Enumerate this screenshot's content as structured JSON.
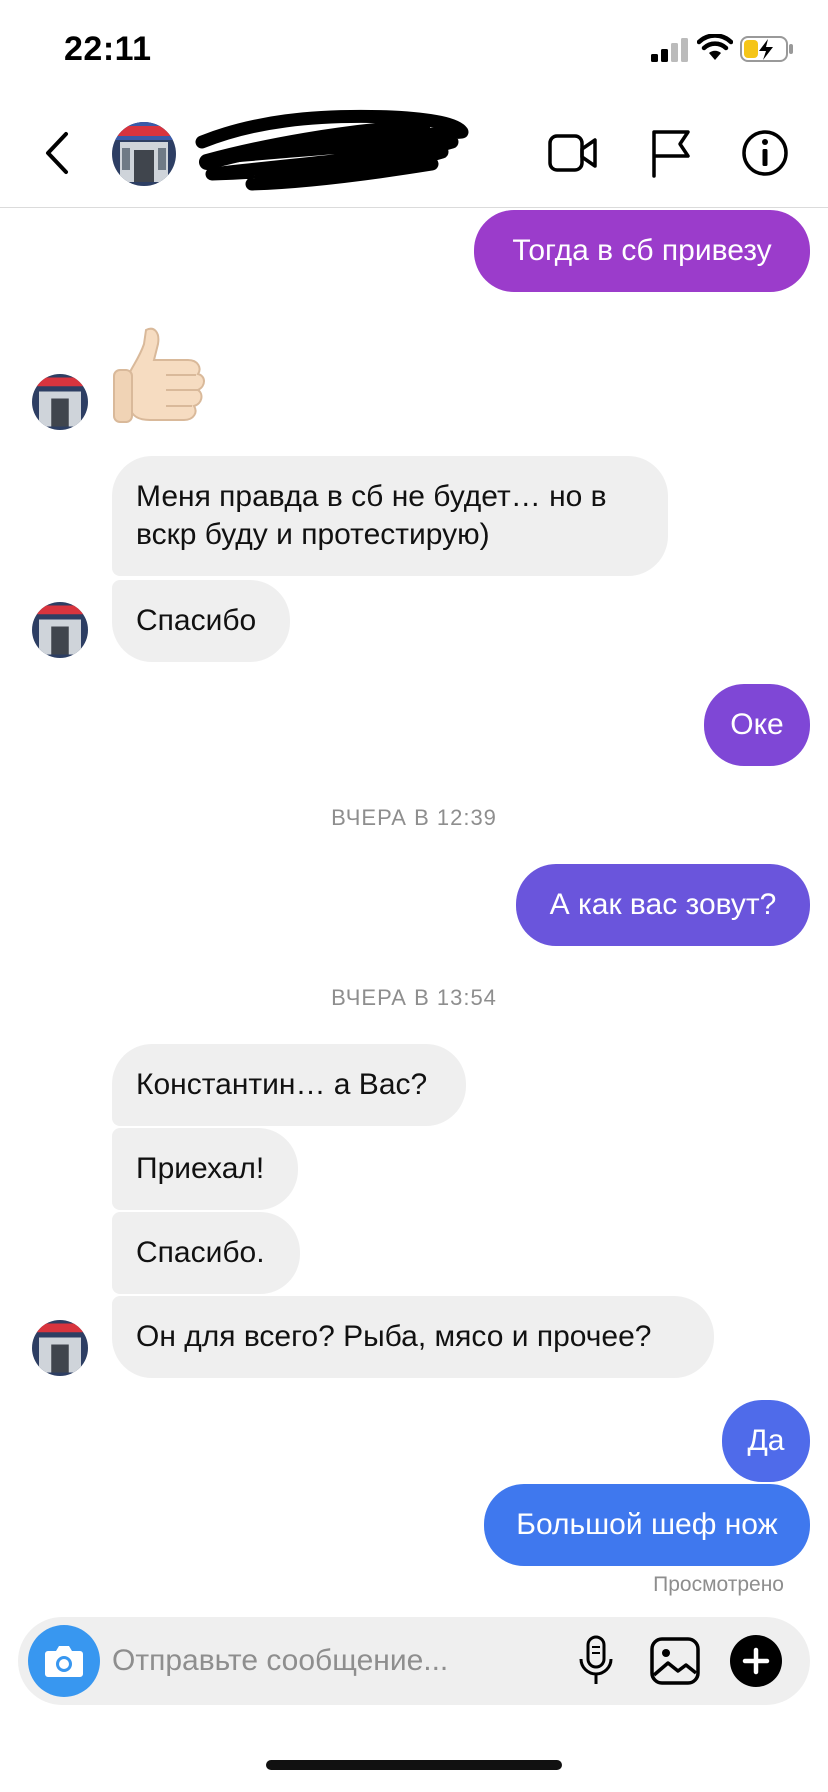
{
  "status_bar": {
    "time": "22:11"
  },
  "header": {
    "username": ""
  },
  "messages": {
    "m1": "Тогда в сб привезу",
    "m3": "Меня правда в сб не будет… но в вскр буду и протестирую)",
    "m4": "Спасибо",
    "m5": "Оке",
    "ts1": "ВЧЕРА В 12:39",
    "m6": "А как вас зовут?",
    "ts2": "ВЧЕРА В 13:54",
    "m7": "Константин… а Вас?",
    "m8": "Приехал!",
    "m9": "Спасибо.",
    "m10": "Он для всего? Рыба, мясо и прочее?",
    "m11": "Да",
    "m12": "Большой шеф нож",
    "seen": "Просмотрено"
  },
  "composer": {
    "placeholder": "Отправьте сообщение..."
  },
  "colors": {
    "outgoing_gradient": [
      "#9b3ccb",
      "#7f47d6",
      "#6a55dc",
      "#4f6bea",
      "#3f78ee"
    ],
    "incoming_bubble": "#efefef",
    "camera_button": "#3897f0"
  },
  "icons": [
    "back-icon",
    "video-call-icon",
    "flag-icon",
    "info-icon",
    "camera-icon",
    "mic-icon",
    "gallery-icon",
    "plus-icon",
    "thumbs-up-emoji"
  ]
}
